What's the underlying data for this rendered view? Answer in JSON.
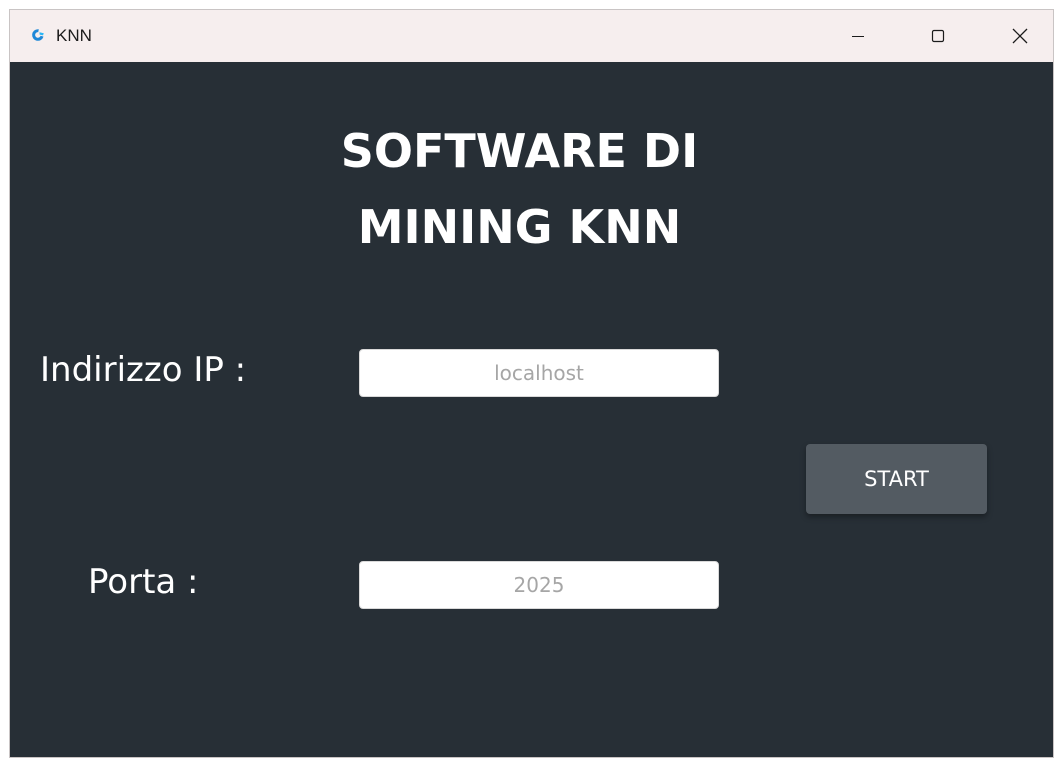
{
  "window": {
    "title": "KNN",
    "icon": "app-icon",
    "controls": {
      "minimize_icon": "minimize-icon",
      "maximize_icon": "maximize-icon",
      "close_icon": "close-icon"
    }
  },
  "main": {
    "heading_line1": "SOFTWARE DI",
    "heading_line2": "MINING KNN",
    "ip": {
      "label": "Indirizzo IP :",
      "placeholder": "localhost",
      "value": ""
    },
    "port": {
      "label": "Porta :",
      "placeholder": "2025",
      "value": ""
    },
    "start_label": "START"
  },
  "colors": {
    "background": "#272f36",
    "titlebar": "#f6eeee",
    "button": "#535b62",
    "text": "#ffffff",
    "placeholder": "#a6a6a6"
  }
}
